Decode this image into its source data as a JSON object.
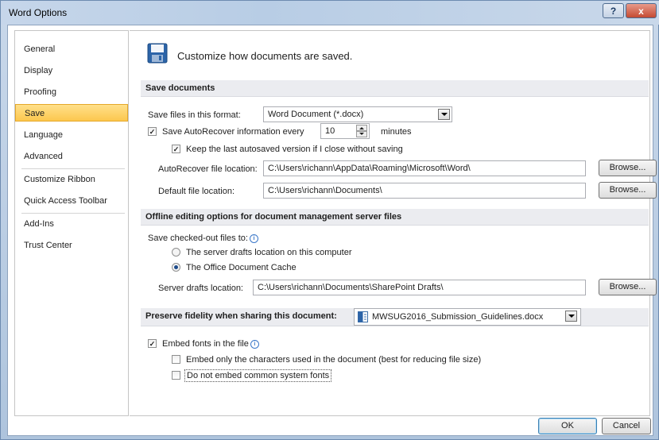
{
  "window": {
    "title": "Word Options",
    "help_label": "?",
    "close_label": "x"
  },
  "nav": {
    "items": [
      "General",
      "Display",
      "Proofing",
      "Save",
      "Language",
      "Advanced",
      "Customize Ribbon",
      "Quick Access Toolbar",
      "Add-Ins",
      "Trust Center"
    ],
    "active": "Save"
  },
  "header": {
    "title": "Customize how documents are saved.",
    "icon": "floppy-disk-icon"
  },
  "save_documents": {
    "heading": "Save documents",
    "format_label": "Save files in this format:",
    "format_value": "Word Document (*.docx)",
    "autorecover_label": "Save AutoRecover information every",
    "autorecover_checked": true,
    "autorecover_minutes": "10",
    "minutes_label": "minutes",
    "keep_last_label": "Keep the last autosaved version if I close without saving",
    "keep_last_checked": true,
    "autorecover_location_label": "AutoRecover file location:",
    "autorecover_location_value": "C:\\Users\\richann\\AppData\\Roaming\\Microsoft\\Word\\",
    "default_location_label": "Default file location:",
    "default_location_value": "C:\\Users\\richann\\Documents\\",
    "browse_label": "Browse..."
  },
  "offline": {
    "heading": "Offline editing options for document management server files",
    "save_checked_out_label": "Save checked-out files to:",
    "option_server": "The server drafts location on this computer",
    "option_cache": "The Office Document Cache",
    "selected": "cache",
    "server_drafts_label": "Server drafts location:",
    "server_drafts_value": "C:\\Users\\richann\\Documents\\SharePoint Drafts\\",
    "browse_label": "Browse..."
  },
  "fidelity": {
    "heading": "Preserve fidelity when sharing this document:",
    "document_value": "MWSUG2016_Submission_Guidelines.docx",
    "embed_fonts_label": "Embed fonts in the file",
    "embed_fonts_checked": true,
    "embed_only_label": "Embed only the characters used in the document (best for reducing file size)",
    "embed_only_checked": false,
    "no_common_label": "Do not embed common system fonts",
    "no_common_checked": false
  },
  "footer": {
    "ok_label": "OK",
    "cancel_label": "Cancel"
  },
  "colors": {
    "accent": "#fcc74e",
    "title_bar": "#c6d6ea",
    "section_header": "#ebecf0"
  }
}
